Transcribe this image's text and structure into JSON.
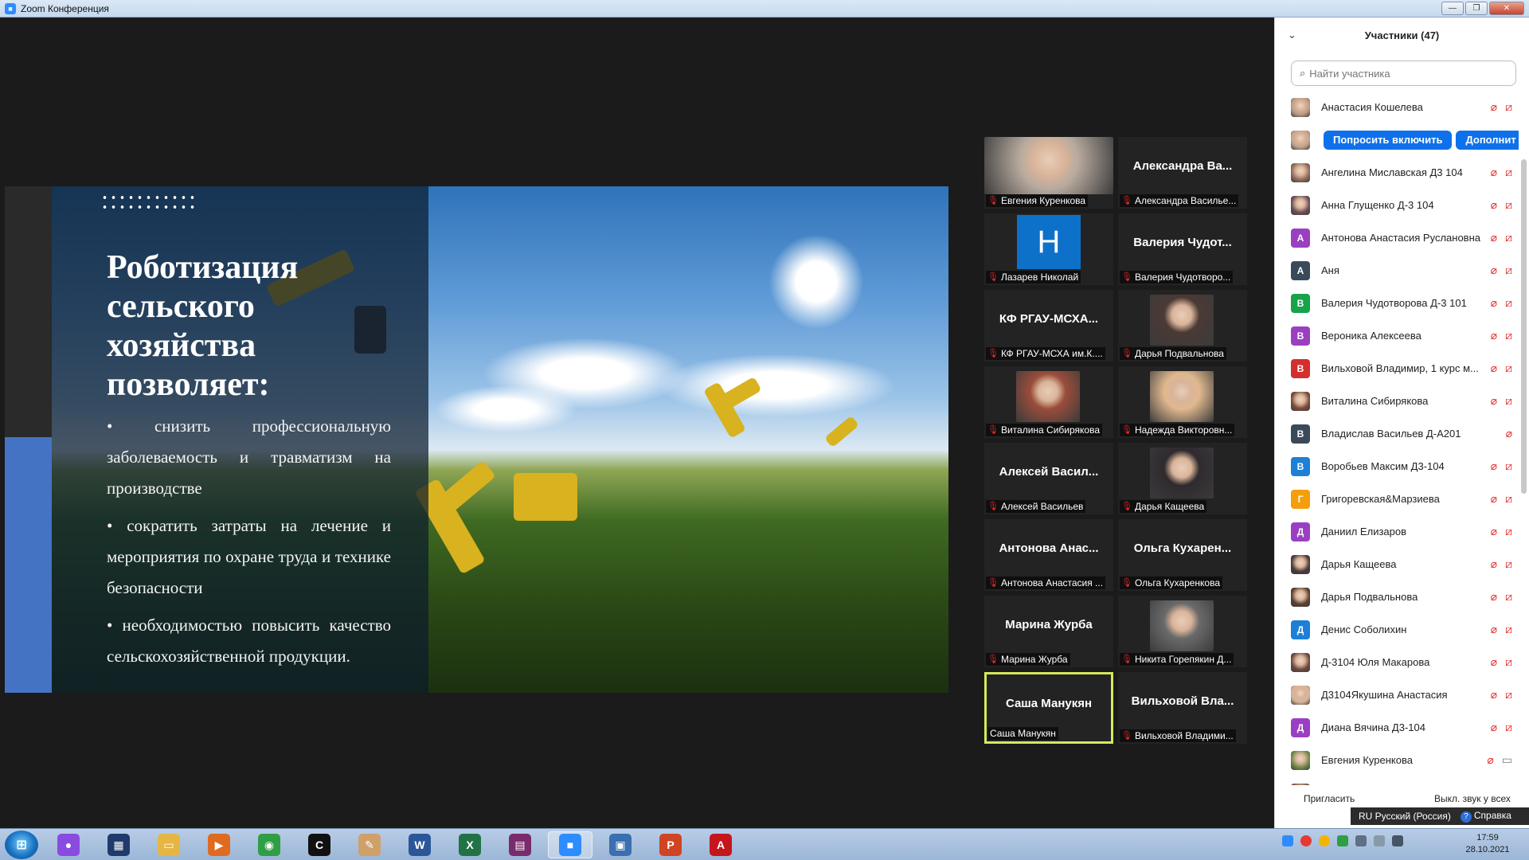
{
  "window": {
    "title": "Zoom Конференция"
  },
  "slide": {
    "title": "Роботизация сельского хозяйства позволяет:",
    "bullets": [
      "• снизить профессиональную заболеваемость и травматизм на производстве",
      "• сократить затраты на лечение и мероприятия по охране труда и технике безопасности",
      "• необходимостью повысить качество сельскохозяйственной продукции."
    ]
  },
  "video_tiles": [
    {
      "big": "",
      "label": "Евгения Куренкова",
      "kind": "photo"
    },
    {
      "big": "Александра Ва...",
      "label": "Александра Василье...",
      "kind": "name"
    },
    {
      "big": "Н",
      "label": "Лазарев Николай",
      "kind": "letter"
    },
    {
      "big": "Валерия Чудот...",
      "label": "Валерия Чудотворо...",
      "kind": "name"
    },
    {
      "big": "КФ РГАУ-МСХА...",
      "label": "КФ РГАУ-МСХА им.К....",
      "kind": "name"
    },
    {
      "big": "",
      "label": "Дарья Подвальнова",
      "kind": "photo"
    },
    {
      "big": "",
      "label": "Виталина Сибирякова",
      "kind": "photo"
    },
    {
      "big": "",
      "label": "Надежда Викторовн...",
      "kind": "photo"
    },
    {
      "big": "Алексей Васил...",
      "label": "Алексей Васильев",
      "kind": "name"
    },
    {
      "big": "",
      "label": "Дарья Кащеева",
      "kind": "photo"
    },
    {
      "big": "Антонова Анас...",
      "label": "Антонова Анастасия ...",
      "kind": "name"
    },
    {
      "big": "Ольга Кухарен...",
      "label": "Ольга Кухаренкова",
      "kind": "name"
    },
    {
      "big": "Марина Журба",
      "label": "Марина Журба",
      "kind": "name"
    },
    {
      "big": "",
      "label": "Никита Горепякин Д...",
      "kind": "photo"
    },
    {
      "big": "Саша Манукян",
      "label": "Саша Манукян",
      "kind": "name",
      "active": true
    },
    {
      "big": "Вильховой Вла...",
      "label": "Вильховой Владими...",
      "kind": "name"
    }
  ],
  "participants_panel": {
    "title": "Участники (47)",
    "search_placeholder": "Найти участника",
    "ask_unmute_label": "Попросить включить",
    "more_label": "Дополнит",
    "invite_label": "Пригласить",
    "mute_all_label": "Выкл. звук у всех",
    "rows": [
      {
        "name": "Анастасия Кошелева",
        "avatar": "photo",
        "color": "#b99a86"
      },
      {
        "name": "",
        "avatar": "photo",
        "color": "#c2a38f",
        "hover": true
      },
      {
        "name": "Ангелина Миславская Д3 104",
        "avatar": "photo",
        "color": "#8f6b5c"
      },
      {
        "name": "Анна Глущенко Д-3 104",
        "avatar": "photo",
        "color": "#6d4f58"
      },
      {
        "name": "Антонова Анастасия Руслановна",
        "avatar": "А",
        "color": "#9b3fc2"
      },
      {
        "name": "Аня",
        "avatar": "А",
        "color": "#3b4a5a"
      },
      {
        "name": "Валерия Чудотворова Д-3 101",
        "avatar": "В",
        "color": "#16a34a"
      },
      {
        "name": "Вероника Алексеева",
        "avatar": "В",
        "color": "#9b3fc2"
      },
      {
        "name": "Вильховой Владимир, 1 курс м...",
        "avatar": "В",
        "color": "#d32f2f"
      },
      {
        "name": "Виталина Сибирякова",
        "avatar": "photo",
        "color": "#7a4a3a"
      },
      {
        "name": "Владислав Васильев Д-А201",
        "avatar": "В",
        "color": "#3b4a5a",
        "video_hidden": true
      },
      {
        "name": "Воробьев Максим Д3-104",
        "avatar": "В",
        "color": "#1e7fd6"
      },
      {
        "name": "Григоревская&Марзиева",
        "avatar": "Г",
        "color": "#f59e0b"
      },
      {
        "name": "Даниил Елизаров",
        "avatar": "Д",
        "color": "#9b3fc2"
      },
      {
        "name": "Дарья Кащеева",
        "avatar": "photo",
        "color": "#4a3a3a"
      },
      {
        "name": "Дарья Подвальнова",
        "avatar": "photo",
        "color": "#5a4030"
      },
      {
        "name": "Денис Соболихин",
        "avatar": "Д",
        "color": "#1e7fd6"
      },
      {
        "name": "Д-3104 Юля Макарова",
        "avatar": "photo",
        "color": "#6b4a40"
      },
      {
        "name": "Д3104Якушина Анастасия",
        "avatar": "photo",
        "color": "#d8b39b"
      },
      {
        "name": "Диана Вячина Д3-104",
        "avatar": "Д",
        "color": "#9b3fc2"
      },
      {
        "name": "Евгения Куренкова",
        "avatar": "photo",
        "color": "#6f8a4a",
        "video_on": true
      },
      {
        "name": "",
        "avatar": "photo",
        "color": "#8a5a4a"
      }
    ]
  },
  "langbar": {
    "language": "RU Русский (Россия)",
    "help_label": "Справка"
  },
  "taskbar": {
    "apps": [
      {
        "name": "alice",
        "color": "#8a4be0",
        "glyph": "●"
      },
      {
        "name": "monitor",
        "color": "#1f3a6b",
        "glyph": "▦"
      },
      {
        "name": "explorer",
        "color": "#e5b644",
        "glyph": "▭"
      },
      {
        "name": "media-player",
        "color": "#e06a1f",
        "glyph": "▶"
      },
      {
        "name": "chrome",
        "color": "#2f9e44",
        "glyph": "◉"
      },
      {
        "name": "chart-app",
        "color": "#111111",
        "glyph": "C"
      },
      {
        "name": "paint",
        "color": "#cfa06a",
        "glyph": "✎"
      },
      {
        "name": "word",
        "color": "#2b579a",
        "glyph": "W"
      },
      {
        "name": "excel",
        "color": "#217346",
        "glyph": "X"
      },
      {
        "name": "winrar",
        "color": "#7a2b6b",
        "glyph": "▤"
      },
      {
        "name": "zoom",
        "color": "#2d8cff",
        "glyph": "■"
      },
      {
        "name": "picture-viewer",
        "color": "#3a6fb0",
        "glyph": "▣"
      },
      {
        "name": "powerpoint",
        "color": "#d04423",
        "glyph": "P"
      },
      {
        "name": "acrobat",
        "color": "#c4161c",
        "glyph": "A"
      }
    ],
    "time": "17:59",
    "date": "28.10.2021"
  }
}
